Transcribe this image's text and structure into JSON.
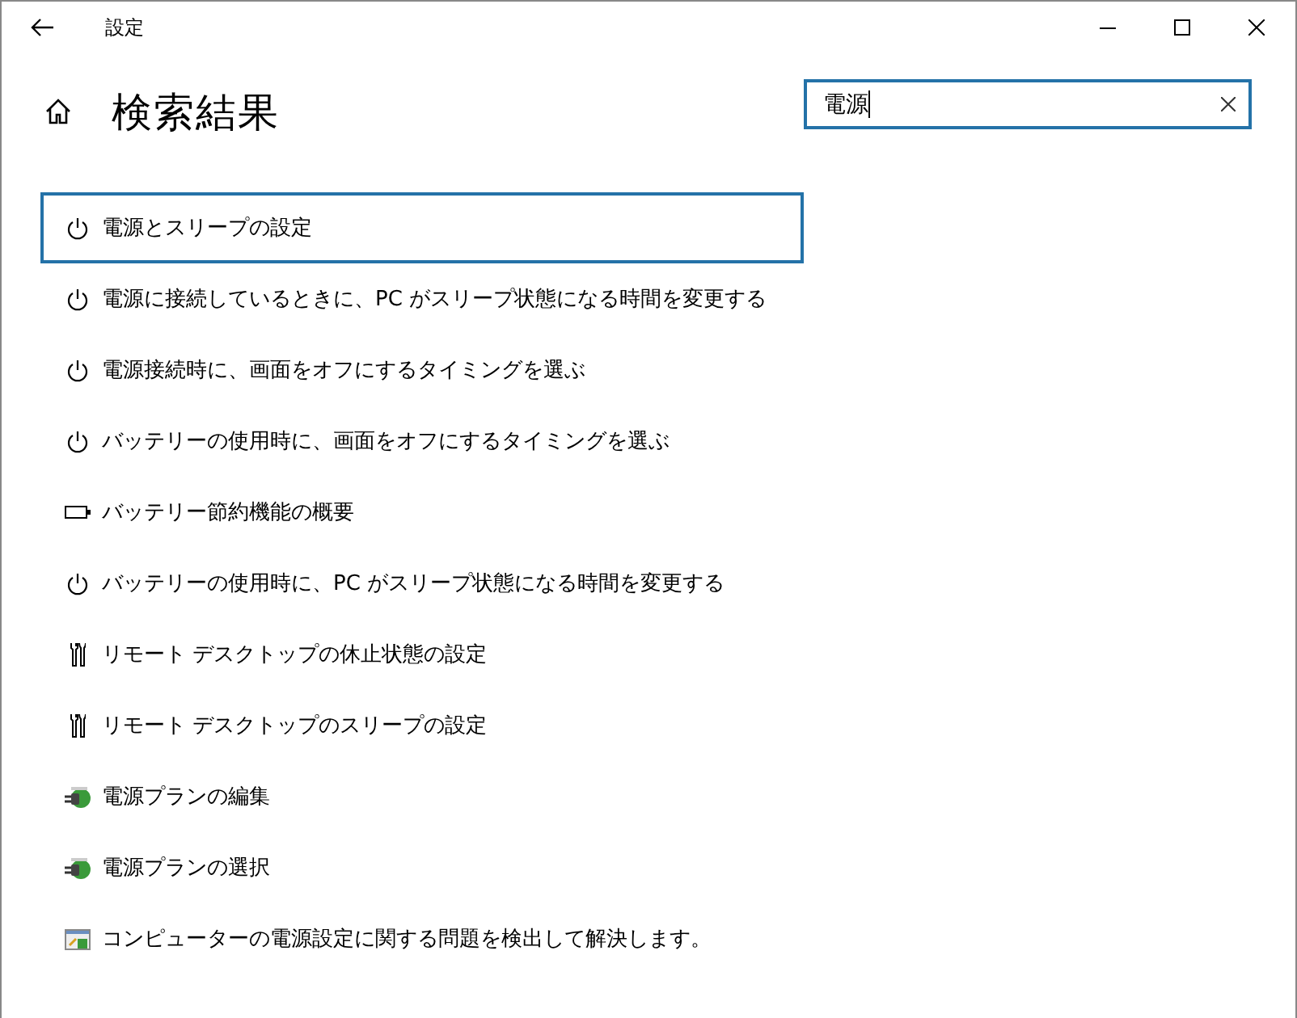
{
  "window": {
    "title": "設定"
  },
  "heading": "検索結果",
  "search": {
    "value": "電源"
  },
  "results": [
    {
      "kind": "power",
      "label": "電源とスリープの設定",
      "selected": true
    },
    {
      "kind": "power",
      "label": "電源に接続しているときに、PC がスリープ状態になる時間を変更する",
      "selected": false
    },
    {
      "kind": "power",
      "label": "電源接続時に、画面をオフにするタイミングを選ぶ",
      "selected": false
    },
    {
      "kind": "power",
      "label": "バッテリーの使用時に、画面をオフにするタイミングを選ぶ",
      "selected": false
    },
    {
      "kind": "battery",
      "label": "バッテリー節約機能の概要",
      "selected": false
    },
    {
      "kind": "power",
      "label": "バッテリーの使用時に、PC がスリープ状態になる時間を変更する",
      "selected": false
    },
    {
      "kind": "remote",
      "label": "リモート デスクトップの休止状態の設定",
      "selected": false
    },
    {
      "kind": "remote",
      "label": "リモート デスクトップのスリープの設定",
      "selected": false
    },
    {
      "kind": "plan",
      "label": "電源プランの編集",
      "selected": false
    },
    {
      "kind": "plan",
      "label": "電源プランの選択",
      "selected": false
    },
    {
      "kind": "troubleshoot",
      "label": "コンピューターの電源設定に関する問題を検出して解決します。",
      "selected": false
    }
  ]
}
